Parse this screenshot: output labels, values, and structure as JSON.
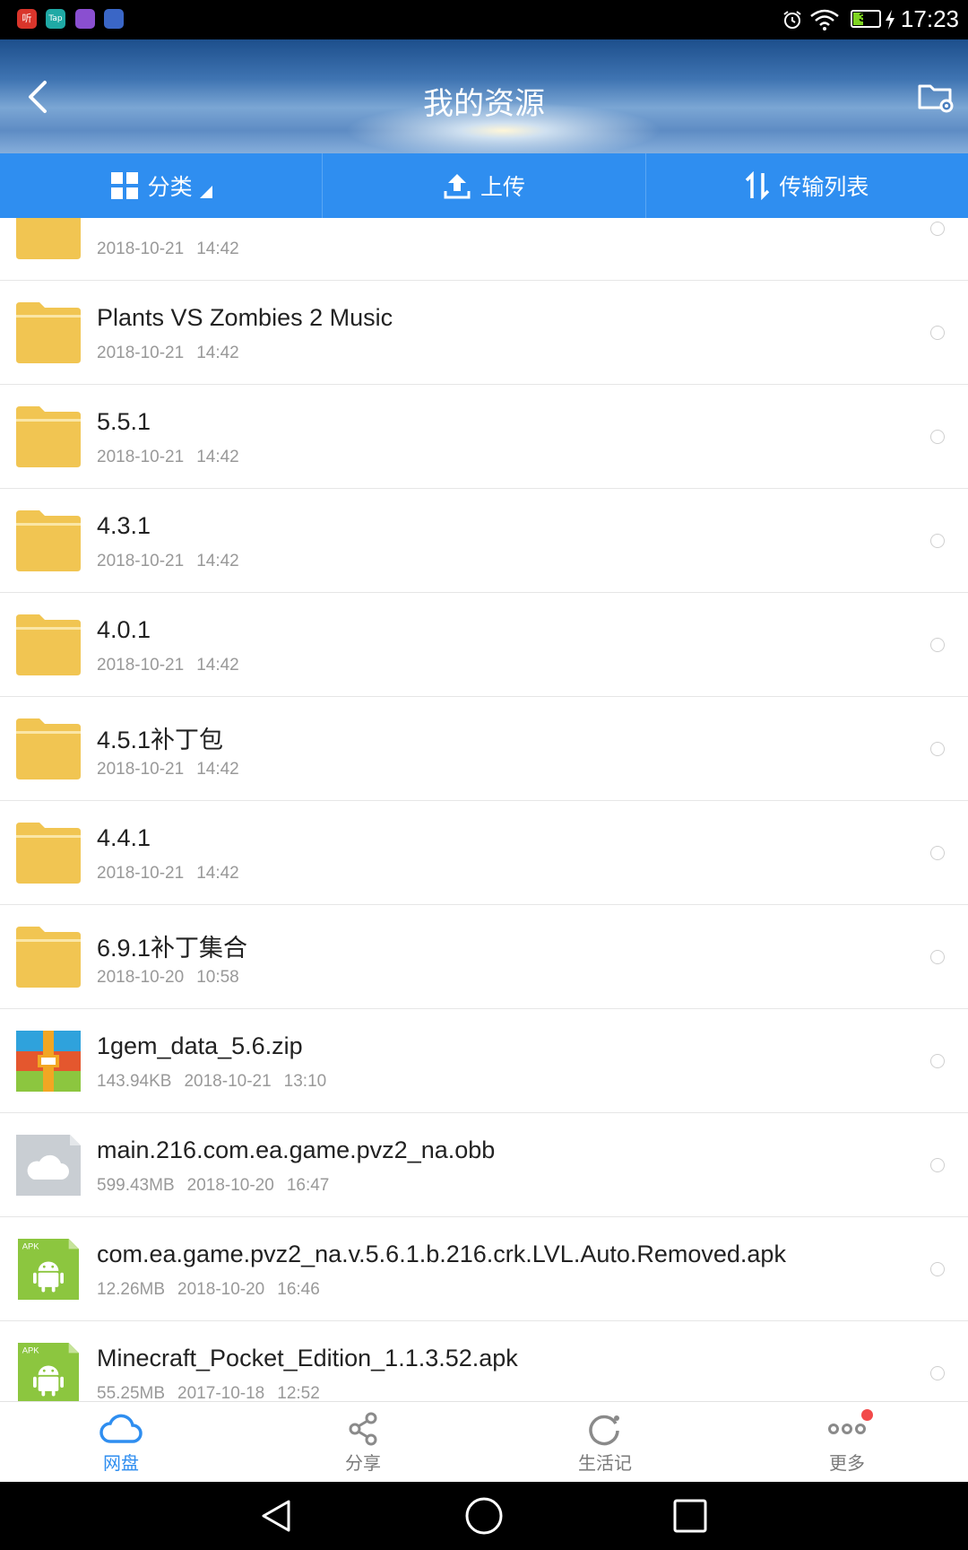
{
  "status_bar": {
    "apps": [
      "听",
      "Tap",
      "",
      ""
    ],
    "battery": "37",
    "time": "17:23"
  },
  "header": {
    "title": "我的资源"
  },
  "tabs": [
    {
      "label": "分类",
      "icon": "grid-icon"
    },
    {
      "label": "上传",
      "icon": "upload-icon"
    },
    {
      "label": "传输列表",
      "icon": "transfer-icon"
    }
  ],
  "files": [
    {
      "name": "",
      "size": "",
      "date": "2018-10-21",
      "time": "14:42",
      "type": "folder"
    },
    {
      "name": "Plants VS Zombies 2 Music",
      "size": "",
      "date": "2018-10-21",
      "time": "14:42",
      "type": "folder"
    },
    {
      "name": "5.5.1",
      "size": "",
      "date": "2018-10-21",
      "time": "14:42",
      "type": "folder"
    },
    {
      "name": "4.3.1",
      "size": "",
      "date": "2018-10-21",
      "time": "14:42",
      "type": "folder"
    },
    {
      "name": "4.0.1",
      "size": "",
      "date": "2018-10-21",
      "time": "14:42",
      "type": "folder"
    },
    {
      "name": "4.5.1补丁包",
      "size": "",
      "date": "2018-10-21",
      "time": "14:42",
      "type": "folder"
    },
    {
      "name": "4.4.1",
      "size": "",
      "date": "2018-10-21",
      "time": "14:42",
      "type": "folder"
    },
    {
      "name": "6.9.1补丁集合",
      "size": "",
      "date": "2018-10-20",
      "time": "10:58",
      "type": "folder"
    },
    {
      "name": "1gem_data_5.6.zip",
      "size": "143.94KB",
      "date": "2018-10-21",
      "time": "13:10",
      "type": "zip"
    },
    {
      "name": "main.216.com.ea.game.pvz2_na.obb",
      "size": "599.43MB",
      "date": "2018-10-20",
      "time": "16:47",
      "type": "unknown"
    },
    {
      "name": "com.ea.game.pvz2_na.v.5.6.1.b.216.crk.LVL.Auto.Removed.apk",
      "size": "12.26MB",
      "date": "2018-10-20",
      "time": "16:46",
      "type": "apk"
    },
    {
      "name": "Minecraft_Pocket_Edition_1.1.3.52.apk",
      "size": "55.25MB",
      "date": "2017-10-18",
      "time": "12:52",
      "type": "apk"
    }
  ],
  "bottom_nav": [
    {
      "label": "网盘",
      "icon": "cloud-icon",
      "active": true
    },
    {
      "label": "分享",
      "icon": "share-icon",
      "active": false
    },
    {
      "label": "生活记",
      "icon": "refresh-icon",
      "active": false
    },
    {
      "label": "更多",
      "icon": "more-icon",
      "active": false,
      "badge": true
    }
  ],
  "colors": {
    "accent": "#2f8ef0",
    "folder": "#f1c552",
    "apk": "#8cc63f"
  }
}
